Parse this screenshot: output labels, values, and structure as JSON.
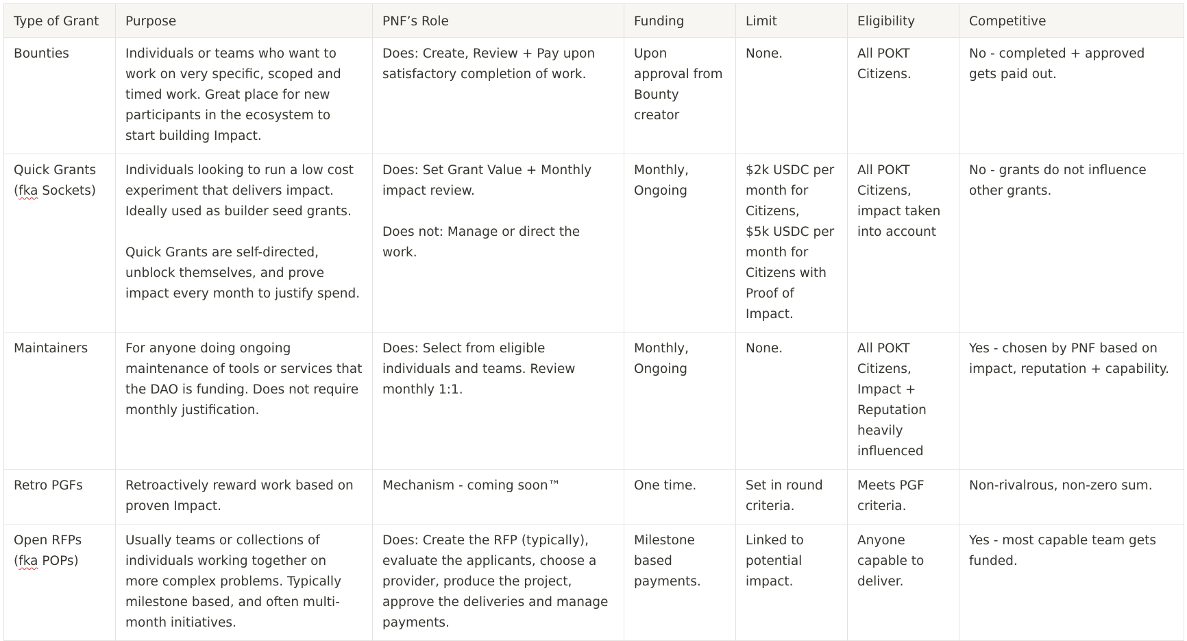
{
  "headers": [
    "Type of Grant",
    "Purpose",
    "PNF’s Role",
    "Funding",
    "Limit",
    "Eligibility",
    "Competitive"
  ],
  "rows": [
    {
      "type": {
        "pre": "Bounties",
        "fka": "",
        "post": ""
      },
      "purpose": "Individuals or teams who want to work on very specific, scoped and timed work. Great place for new participants in the ecosystem to start building Impact.",
      "role": "Does: Create, Review + Pay upon satisfactory completion of work.",
      "funding": "Upon approval from Bounty creator",
      "limit": "None.",
      "eligibility": "All POKT Citizens.",
      "competitive": "No - completed + approved gets paid out."
    },
    {
      "type": {
        "pre": "Quick Grants\n(",
        "fka": "fka",
        "post": " Sockets)"
      },
      "purpose": "Individuals looking to run a low cost experiment that delivers impact. Ideally used as builder seed grants.\n\nQuick Grants are self-directed, unblock themselves, and prove impact every month to justify spend.",
      "role": "Does: Set Grant Value + Monthly impact review.\n\nDoes not: Manage or direct the work.",
      "funding": "Monthly, Ongoing",
      "limit": "$2k USDC per month for Citizens,\n$5k USDC per month for Citizens with Proof of Impact.",
      "eligibility": "All POKT Citizens, impact taken into account",
      "competitive": "No - grants do not influence other grants."
    },
    {
      "type": {
        "pre": "Maintainers",
        "fka": "",
        "post": ""
      },
      "purpose": "For anyone doing ongoing maintenance of tools or services that the DAO is funding. Does not require monthly justification.",
      "role": "Does: Select from eligible individuals and teams. Review monthly 1:1.",
      "funding": "Monthly, Ongoing",
      "limit": "None.",
      "eligibility": "All POKT Citizens, Impact + Reputation heavily influenced",
      "competitive": "Yes - chosen by PNF based on impact, reputation + capability."
    },
    {
      "type": {
        "pre": "Retro PGFs",
        "fka": "",
        "post": ""
      },
      "purpose": "Retroactively reward work based on proven Impact.",
      "role": "Mechanism - coming soon™",
      "funding": "One time.",
      "limit": "Set in round criteria.",
      "eligibility": "Meets PGF criteria.",
      "competitive": "Non-rivalrous, non-zero sum."
    },
    {
      "type": {
        "pre": "Open RFPs\n(",
        "fka": "fka",
        "post": " POPs)"
      },
      "purpose": "Usually teams or collections of individuals working together on more complex problems. Typically milestone based, and often multi-month initiatives.",
      "role": "Does: Create the RFP (typically), evaluate the applicants, choose a provider, produce the project, approve the deliveries and manage payments.",
      "funding": "Milestone based payments.",
      "limit": "Linked to potential impact.",
      "eligibility": "Anyone capable to deliver.",
      "competitive": "Yes - most capable team gets funded."
    }
  ]
}
